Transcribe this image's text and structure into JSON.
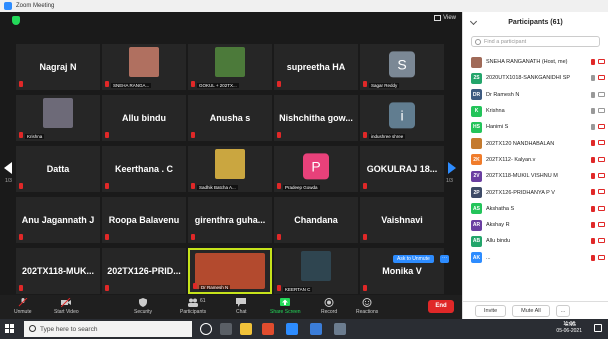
{
  "window": {
    "title": "Zoom Meeting"
  },
  "meeting": {
    "view_label": "View",
    "page_left": "1/3",
    "page_right": "1/3",
    "ask_to_unmute": "Ask to Unmute",
    "ask_more": "···",
    "tiles": [
      {
        "name": "Nagraj N",
        "label": "",
        "type": "name"
      },
      {
        "name": "",
        "label": "SNEHA RANGA...",
        "type": "photo",
        "color": "#b07060"
      },
      {
        "name": "",
        "label": "GOKUL + 202TX...",
        "type": "photo",
        "color": "#4c7a3a"
      },
      {
        "name": "supreetha HA",
        "label": "",
        "type": "name"
      },
      {
        "name": "S",
        "label": "Sagar Reddy",
        "type": "letter",
        "color": "#7b8895"
      },
      {
        "name": "",
        "label": "Krishna",
        "type": "photo",
        "color": "#6d6a78"
      },
      {
        "name": "Allu bindu",
        "label": "",
        "type": "name"
      },
      {
        "name": "Anusha s",
        "label": "",
        "type": "name"
      },
      {
        "name": "Nishchitha gow...",
        "label": "",
        "type": "name"
      },
      {
        "name": "i",
        "label": "indushree shree",
        "type": "letter",
        "color": "#617d90"
      },
      {
        "name": "Datta",
        "label": "",
        "type": "name"
      },
      {
        "name": "Keerthana . C",
        "label": "",
        "type": "name"
      },
      {
        "name": "",
        "label": "Sadhik Batcha A...",
        "type": "photo",
        "color": "#caa640"
      },
      {
        "name": "P",
        "label": "Pradeep Gowda",
        "type": "letter",
        "color": "#e8417a"
      },
      {
        "name": "GOKULRAJ  18...",
        "label": "",
        "type": "name"
      },
      {
        "name": "Anu Jagannath J",
        "label": "",
        "type": "name"
      },
      {
        "name": "Roopa Balavenu",
        "label": "",
        "type": "name"
      },
      {
        "name": "girenthra  guha...",
        "label": "",
        "type": "name"
      },
      {
        "name": "Chandana",
        "label": "",
        "type": "name"
      },
      {
        "name": "Vaishnavi",
        "label": "",
        "type": "name"
      },
      {
        "name": "202TX118-MUK...",
        "label": "",
        "type": "name"
      },
      {
        "name": "202TX126-PRID...",
        "label": "",
        "type": "name"
      },
      {
        "name": "",
        "label": "Dr Ramesh N",
        "type": "photo",
        "color": "#b34a2e",
        "active": true
      },
      {
        "name": "",
        "label": "KEERTAN C",
        "type": "photo",
        "color": "#2f4550"
      },
      {
        "name": "Monika V",
        "label": "",
        "type": "name"
      }
    ]
  },
  "toolbar": {
    "unmute": "Unmute",
    "start_video": "Start Video",
    "security": "Security",
    "participants": "Participants",
    "participants_count": "61",
    "chat": "Chat",
    "share_screen": "Share Screen",
    "record": "Record",
    "reactions": "Reactions",
    "end": "End"
  },
  "panel": {
    "title": "Participants (61)",
    "search_placeholder": "Find a participant",
    "invite": "Invite",
    "mute_all": "Mute All",
    "more": "...",
    "participants": [
      {
        "initials": "",
        "name": "SNEHA RANGANATH (Host, me)",
        "color": "#a06a58",
        "mic": "muted",
        "cam": "off"
      },
      {
        "initials": "2S",
        "name": "2020UTX1018-SANKGANIDHI SP",
        "color": "#23a56b",
        "mic": "on",
        "cam": "off"
      },
      {
        "initials": "DR",
        "name": "Dr Ramesh N",
        "color": "#3d5a80",
        "mic": "on",
        "cam": "on"
      },
      {
        "initials": "K",
        "name": "Krishna",
        "color": "#23c45a",
        "mic": "on",
        "cam": "on"
      },
      {
        "initials": "HS",
        "name": "Hanimi S",
        "color": "#23c45a",
        "mic": "on",
        "cam": "off"
      },
      {
        "initials": "",
        "name": "202TX120 NANDHABALAN",
        "color": "#c47a2e",
        "mic": "muted",
        "cam": "off"
      },
      {
        "initials": "2K",
        "name": "202TX112- Kalyan.v",
        "color": "#f07c2b",
        "mic": "muted",
        "cam": "off"
      },
      {
        "initials": "2V",
        "name": "202TX118-MUKIL VISHNU M",
        "color": "#6a3ea1",
        "mic": "muted",
        "cam": "off"
      },
      {
        "initials": "2P",
        "name": "202TX126-PRIDHANYA P V",
        "color": "#3d4a66",
        "mic": "muted",
        "cam": "off"
      },
      {
        "initials": "AS",
        "name": "Akshatha S",
        "color": "#23c45a",
        "mic": "muted",
        "cam": "off"
      },
      {
        "initials": "AR",
        "name": "Akshay R",
        "color": "#6a3ea1",
        "mic": "muted",
        "cam": "off"
      },
      {
        "initials": "AB",
        "name": "Allu bindu",
        "color": "#23a56b",
        "mic": "muted",
        "cam": "off"
      },
      {
        "initials": "AK",
        "name": "...",
        "color": "#2d8cff",
        "mic": "muted",
        "cam": "off"
      }
    ]
  },
  "taskbar": {
    "search_placeholder": "Type here to search",
    "lang": "ENG",
    "time": "11:06",
    "date": "05-06-2021"
  }
}
